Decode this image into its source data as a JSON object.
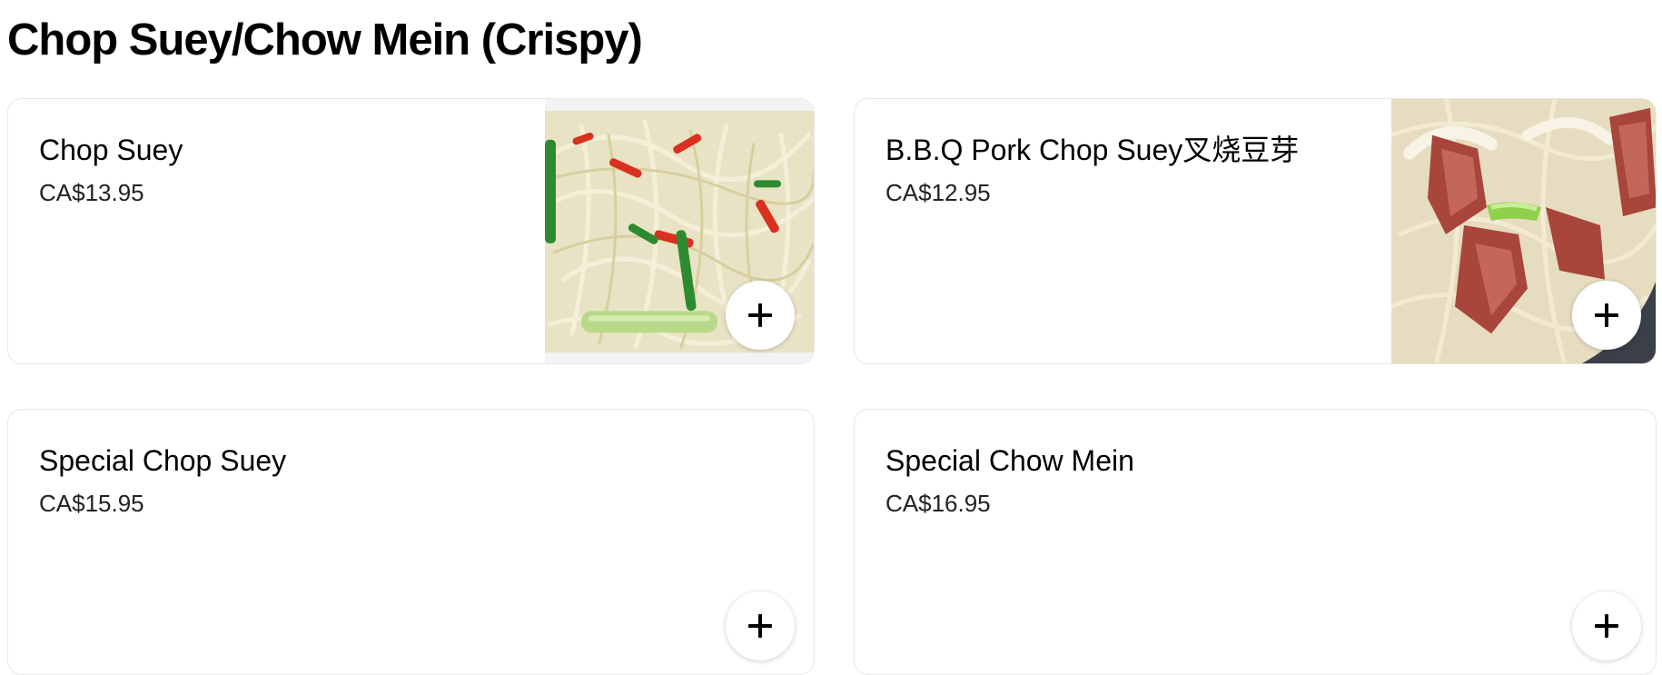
{
  "section": {
    "title": "Chop Suey/Chow Mein (Crispy)"
  },
  "items": [
    {
      "name": "Chop Suey",
      "price": "CA$13.95",
      "image": "chop-suey-photo",
      "add_icon": "plus-icon"
    },
    {
      "name": "B.B.Q Pork Chop Suey叉烧豆芽",
      "price": "CA$12.95",
      "image": "bbq-pork-chop-suey-photo",
      "add_icon": "plus-icon"
    },
    {
      "name": "Special Chop Suey",
      "price": "CA$15.95",
      "add_icon": "plus-icon"
    },
    {
      "name": "Special Chow Mein",
      "price": "CA$16.95",
      "add_icon": "plus-icon"
    }
  ]
}
